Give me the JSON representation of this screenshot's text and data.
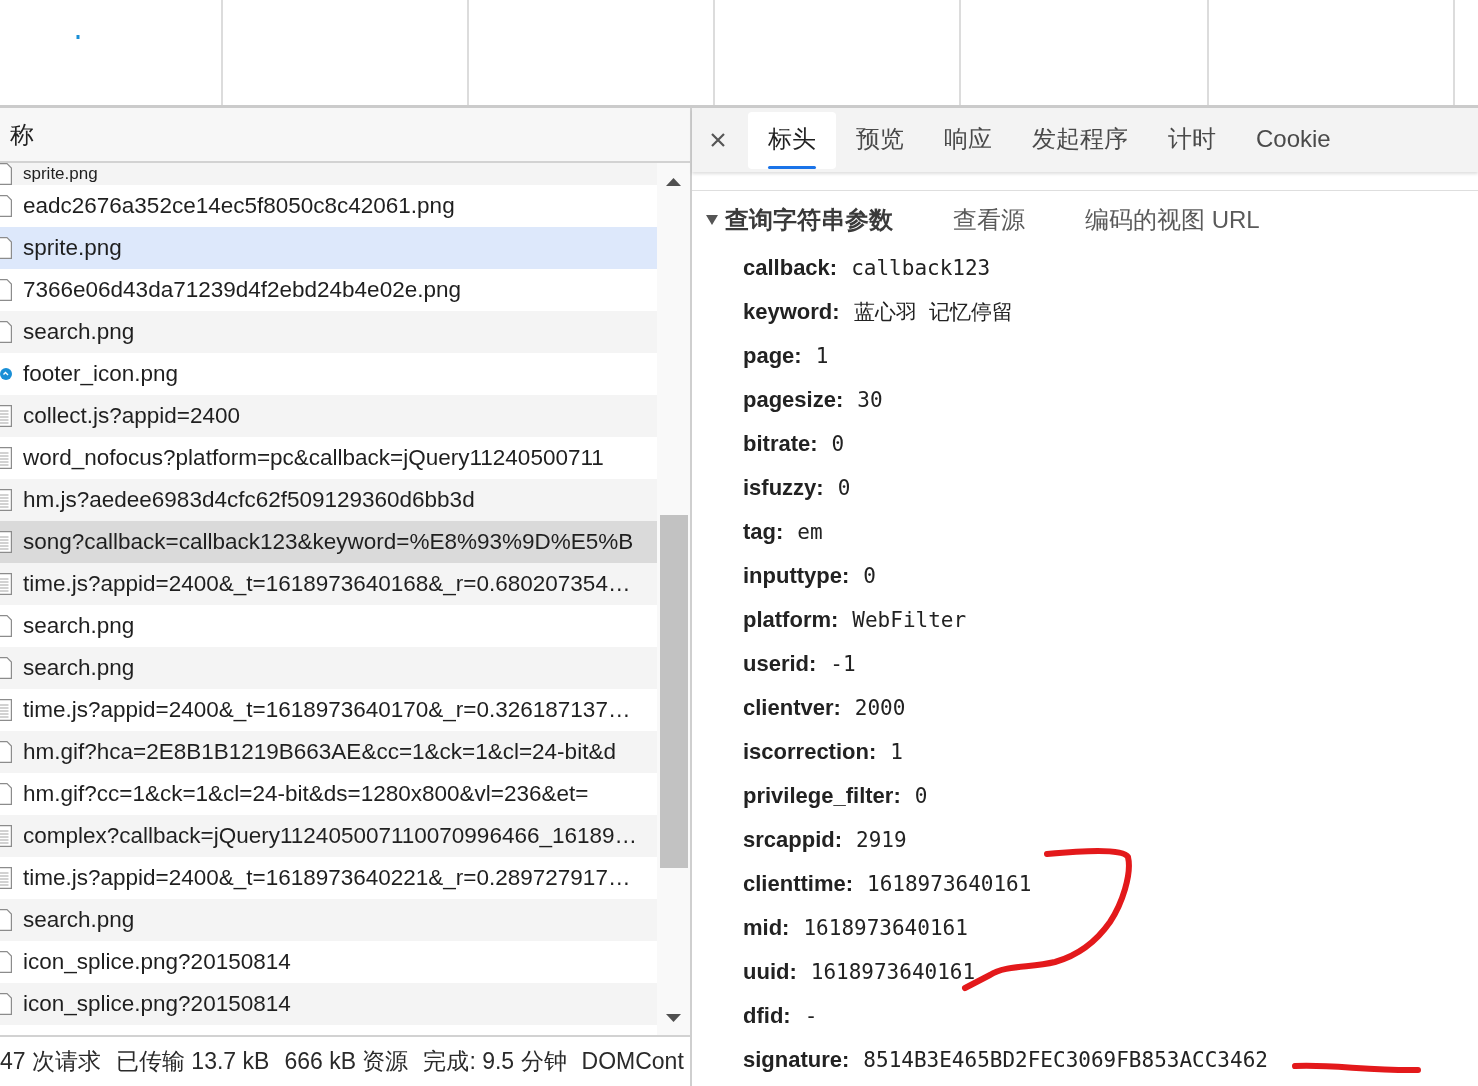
{
  "request_list": {
    "header": "称",
    "rows": [
      {
        "name": "sprite.png",
        "kind": "image",
        "selected": false,
        "highlighted": false
      },
      {
        "name": "eadc2676a352ce14ec5f8050c8c42061.png",
        "kind": "image",
        "selected": false,
        "highlighted": false
      },
      {
        "name": "sprite.png",
        "kind": "image",
        "selected": false,
        "highlighted": true
      },
      {
        "name": "7366e06d43da71239d4f2ebd24b4e02e.png",
        "kind": "image",
        "selected": false,
        "highlighted": false
      },
      {
        "name": "search.png",
        "kind": "image",
        "selected": false,
        "highlighted": false
      },
      {
        "name": "footer_icon.png",
        "kind": "badge",
        "selected": false,
        "highlighted": false
      },
      {
        "name": "collect.js?appid=2400",
        "kind": "script",
        "selected": false,
        "highlighted": false
      },
      {
        "name": "word_nofocus?platform=pc&callback=jQuery11240500711",
        "kind": "script",
        "selected": false,
        "highlighted": false
      },
      {
        "name": "hm.js?aedee6983d4cfc62f509129360d6bb3d",
        "kind": "script",
        "selected": false,
        "highlighted": false
      },
      {
        "name": "song?callback=callback123&keyword=%E8%93%9D%E5%B",
        "kind": "script",
        "selected": true,
        "highlighted": false
      },
      {
        "name": "time.js?appid=2400&_t=1618973640168&_r=0.680207354…",
        "kind": "script",
        "selected": false,
        "highlighted": false
      },
      {
        "name": "search.png",
        "kind": "image",
        "selected": false,
        "highlighted": false
      },
      {
        "name": "search.png",
        "kind": "image",
        "selected": false,
        "highlighted": false
      },
      {
        "name": "time.js?appid=2400&_t=1618973640170&_r=0.326187137…",
        "kind": "script",
        "selected": false,
        "highlighted": false
      },
      {
        "name": "hm.gif?hca=2E8B1B1219B663AE&cc=1&ck=1&cl=24-bit&d",
        "kind": "image",
        "selected": false,
        "highlighted": false
      },
      {
        "name": "hm.gif?cc=1&ck=1&cl=24-bit&ds=1280x800&vl=236&et=",
        "kind": "image",
        "selected": false,
        "highlighted": false
      },
      {
        "name": "complex?callback=jQuery112405007110070996466_16189…",
        "kind": "script",
        "selected": false,
        "highlighted": false
      },
      {
        "name": "time.js?appid=2400&_t=1618973640221&_r=0.289727917…",
        "kind": "script",
        "selected": false,
        "highlighted": false
      },
      {
        "name": "search.png",
        "kind": "image",
        "selected": false,
        "highlighted": false
      },
      {
        "name": "icon_splice.png?20150814",
        "kind": "image",
        "selected": false,
        "highlighted": false
      },
      {
        "name": "icon_splice.png?20150814",
        "kind": "image",
        "selected": false,
        "highlighted": false
      }
    ]
  },
  "status_bar": [
    "47 次请求",
    "已传输 13.7 kB",
    "666 kB 资源",
    "完成: 9.5 分钟",
    "DOMCont"
  ],
  "details": {
    "tabs": [
      {
        "label": "标头",
        "selected": true
      },
      {
        "label": "预览",
        "selected": false
      },
      {
        "label": "响应",
        "selected": false
      },
      {
        "label": "发起程序",
        "selected": false
      },
      {
        "label": "计时",
        "selected": false
      },
      {
        "label": "Cookie",
        "selected": false
      }
    ],
    "section": {
      "title": "查询字符串参数",
      "expanded": true,
      "actions": [
        "查看源",
        "编码的视图 URL"
      ]
    },
    "params": [
      {
        "key": "callback:",
        "value": "callback123"
      },
      {
        "key": "keyword:",
        "value": "蓝心羽 记忆停留"
      },
      {
        "key": "page:",
        "value": "1"
      },
      {
        "key": "pagesize:",
        "value": "30"
      },
      {
        "key": "bitrate:",
        "value": "0"
      },
      {
        "key": "isfuzzy:",
        "value": "0"
      },
      {
        "key": "tag:",
        "value": "em"
      },
      {
        "key": "inputtype:",
        "value": "0"
      },
      {
        "key": "platform:",
        "value": "WebFilter"
      },
      {
        "key": "userid:",
        "value": "-1"
      },
      {
        "key": "clientver:",
        "value": "2000"
      },
      {
        "key": "iscorrection:",
        "value": "1"
      },
      {
        "key": "privilege_filter:",
        "value": "0"
      },
      {
        "key": "srcappid:",
        "value": "2919"
      },
      {
        "key": "clienttime:",
        "value": "1618973640161"
      },
      {
        "key": "mid:",
        "value": "1618973640161"
      },
      {
        "key": "uuid:",
        "value": "1618973640161"
      },
      {
        "key": "dfid:",
        "value": "-"
      },
      {
        "key": "signature:",
        "value": "8514B3E465BD2FEC3069FB853ACC3462"
      }
    ]
  }
}
